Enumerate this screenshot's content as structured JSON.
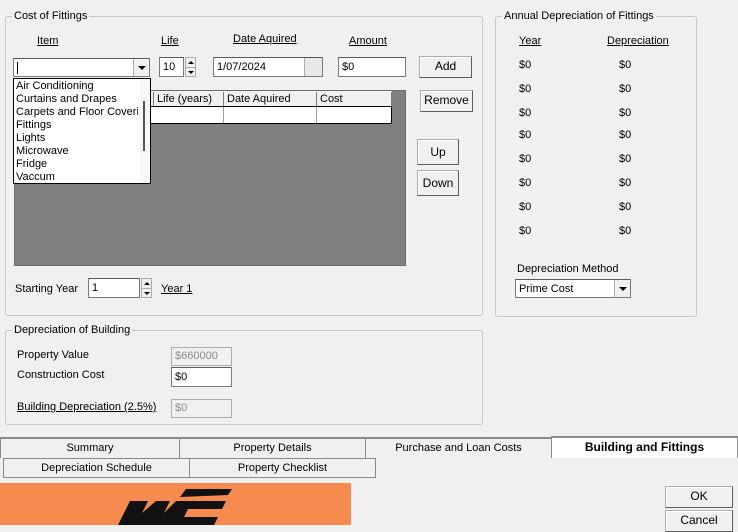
{
  "fittings": {
    "title": "Cost of Fittings",
    "item_label": "Item",
    "life_label": "Life",
    "date_label": "Date Aquired",
    "amount_label": "Amount",
    "item_value": "",
    "life_value": "10",
    "date_value": "1/07/2024",
    "amount_value": "$0",
    "add_label": "Add",
    "remove_label": "Remove",
    "up_label": "Up",
    "down_label": "Down",
    "dropdown_options": [
      "Air Conditioning",
      "Curtains and Drapes",
      "Carpets and Floor Coverings",
      "Fittings",
      "Lights",
      "Microwave",
      "Fridge",
      "Vaccum"
    ],
    "grid_columns": [
      "Life (years)",
      "Date Aquired",
      "Cost"
    ],
    "starting_year_label": "Starting Year",
    "starting_year_value": "1",
    "year_link": "Year 1"
  },
  "annual": {
    "title": "Annual Depreciation of Fittings",
    "year_header": "Year",
    "dep_header": "Depreciation",
    "rows": [
      {
        "year": "$0",
        "dep": "$0"
      },
      {
        "year": "$0",
        "dep": "$0"
      },
      {
        "year": "$0",
        "dep": "$0"
      },
      {
        "year": "$0",
        "dep": "$0"
      },
      {
        "year": "$0",
        "dep": "$0"
      },
      {
        "year": "$0",
        "dep": "$0"
      },
      {
        "year": "$0",
        "dep": "$0"
      },
      {
        "year": "$0",
        "dep": "$0"
      }
    ],
    "method_label": "Depreciation Method",
    "method_value": "Prime Cost"
  },
  "building": {
    "title": "Depreciation of Building",
    "property_value_label": "Property Value",
    "property_value": "$660000",
    "construction_label": "Construction Cost",
    "construction_value": "$0",
    "building_dep_label": "Building Depreciation (2.5%)",
    "building_dep_value": "$0"
  },
  "tabs": {
    "row1": [
      "Summary",
      "Property Details",
      "Purchase and Loan Costs",
      "Building and Fittings"
    ],
    "row2": [
      "Depreciation Schedule",
      "Property Checklist"
    ]
  },
  "footer": {
    "ok_label": "OK",
    "cancel_label": "Cancel"
  },
  "colors": {
    "logo_bg": "#f68a4f",
    "grid_bg": "#808080"
  }
}
